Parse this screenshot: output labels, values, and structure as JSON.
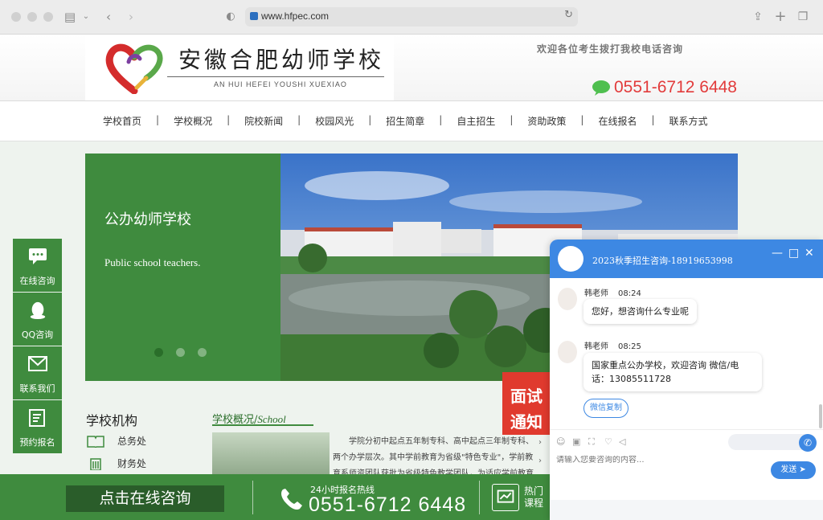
{
  "browser": {
    "url": "www.hfpec.com"
  },
  "header": {
    "school_name_cn": "安徽合肥幼师学校",
    "school_name_en": "AN HUI HEFEI YOUSHI XUEXIAO",
    "welcome": "欢迎各位考生拨打我校电话咨询",
    "phone": "0551-6712 6448"
  },
  "nav": {
    "items": [
      "学校首页",
      "学校概况",
      "院校新闻",
      "校园风光",
      "招生简章",
      "自主招生",
      "资助政策",
      "在线报名",
      "联系方式"
    ],
    "separator": "|"
  },
  "banner": {
    "title": "公办幼师学校",
    "subtitle": "Public school teachers."
  },
  "sidebar": {
    "items": [
      {
        "label": "在线咨询",
        "icon": "chat-bubble-icon"
      },
      {
        "label": "QQ咨询",
        "icon": "qq-penguin-icon"
      },
      {
        "label": "联系我们",
        "icon": "envelope-icon"
      },
      {
        "label": "预约报名",
        "icon": "form-icon"
      }
    ]
  },
  "org": {
    "title": "学校机构",
    "items": [
      {
        "label": "总务处",
        "icon": "book-icon"
      },
      {
        "label": "财务处",
        "icon": "building-icon"
      }
    ]
  },
  "school_intro": {
    "title_cn": "学校概况/",
    "title_en": "School",
    "text": "学院分初中起点五年制专科、高中起点三年制专科、两个办学层次。其中学前教育为省级\"特色专业\"，学前教育系师资团队获批为省级特色教学团队，为适应学前教育"
  },
  "red_badge": {
    "text": "面试通知"
  },
  "bottom_bar": {
    "consult": "点击在线咨询",
    "hotline_label": "24小时报名热线",
    "hotline_number": "0551-6712 6448",
    "course_label": "热门课程"
  },
  "chat": {
    "title": "2023秋季招生咨询-18919653998",
    "messages": [
      {
        "sender": "韩老师",
        "time": "08:24",
        "text": "您好，想咨询什么专业呢"
      },
      {
        "sender": "韩老师",
        "time": "08:25",
        "text": "国家重点公办学校，欢迎咨询 微信/电话：13085511728"
      }
    ],
    "wechat_copy": "微信复制",
    "input_placeholder": "请输入您要咨询的内容...",
    "send": "发送"
  },
  "colors": {
    "brand_green": "#3f8b3e",
    "phone_red": "#e23b3b",
    "chat_blue": "#3d88e3"
  }
}
